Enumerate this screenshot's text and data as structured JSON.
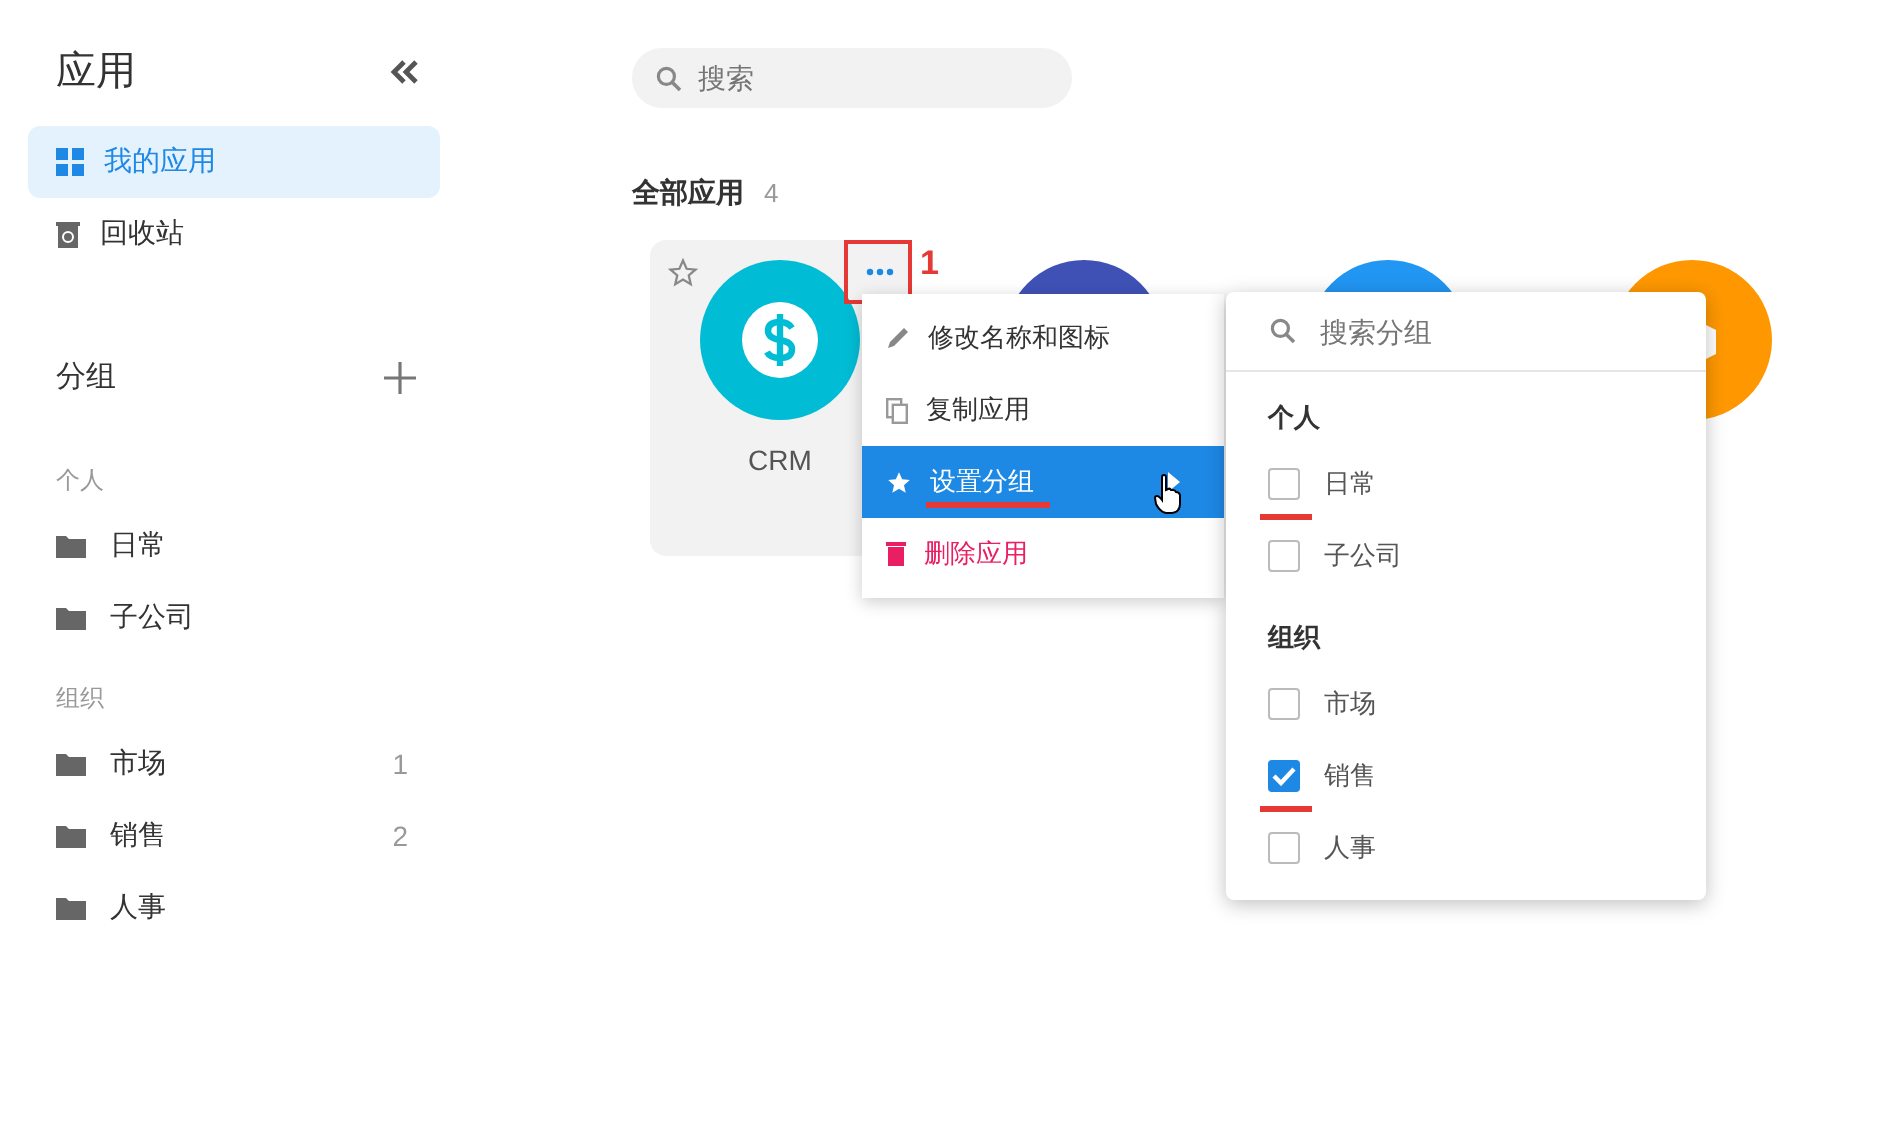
{
  "sidebar": {
    "title": "应用",
    "nav": [
      {
        "label": "我的应用",
        "selected": true,
        "kind": "grid"
      },
      {
        "label": "回收站",
        "selected": false,
        "kind": "trash"
      }
    ],
    "groups_title": "分组",
    "sections": [
      {
        "title": "个人",
        "items": [
          {
            "label": "日常"
          },
          {
            "label": "子公司"
          }
        ]
      },
      {
        "title": "组织",
        "items": [
          {
            "label": "市场",
            "count": "1"
          },
          {
            "label": "销售",
            "count": "2"
          },
          {
            "label": "人事"
          }
        ]
      }
    ]
  },
  "search": {
    "placeholder": "搜索"
  },
  "apps_title": "全部应用",
  "apps_count": "4",
  "apps": [
    {
      "label": "CRM",
      "color": "#00bcd4",
      "kind": "dollar",
      "hovered": true
    },
    {
      "color": "#3f51b5",
      "kind": "plain",
      "hovered": false
    },
    {
      "color": "#2196f3",
      "kind": "plain",
      "hovered": false
    },
    {
      "color": "#ff9800",
      "kind": "box",
      "hovered": false
    }
  ],
  "annotation": {
    "label": "1"
  },
  "menu": [
    {
      "label": "修改名称和图标",
      "kind": "edit",
      "selected": false,
      "underlined": false
    },
    {
      "label": "复制应用",
      "kind": "copy",
      "selected": false,
      "underlined": false
    },
    {
      "label": "设置分组",
      "kind": "star",
      "selected": true,
      "underlined": true
    },
    {
      "label": "删除应用",
      "kind": "delete",
      "selected": false,
      "underlined": false
    }
  ],
  "submenu": {
    "placeholder": "搜索分组",
    "sections": [
      {
        "title": "个人",
        "items": [
          {
            "label": "日常",
            "checked": false,
            "underlined": true
          },
          {
            "label": "子公司",
            "checked": false,
            "underlined": false
          }
        ]
      },
      {
        "title": "组织",
        "items": [
          {
            "label": "市场",
            "checked": false,
            "underlined": false
          },
          {
            "label": "销售",
            "checked": true,
            "underlined": true
          },
          {
            "label": "人事",
            "checked": false,
            "underlined": false
          }
        ]
      }
    ]
  }
}
